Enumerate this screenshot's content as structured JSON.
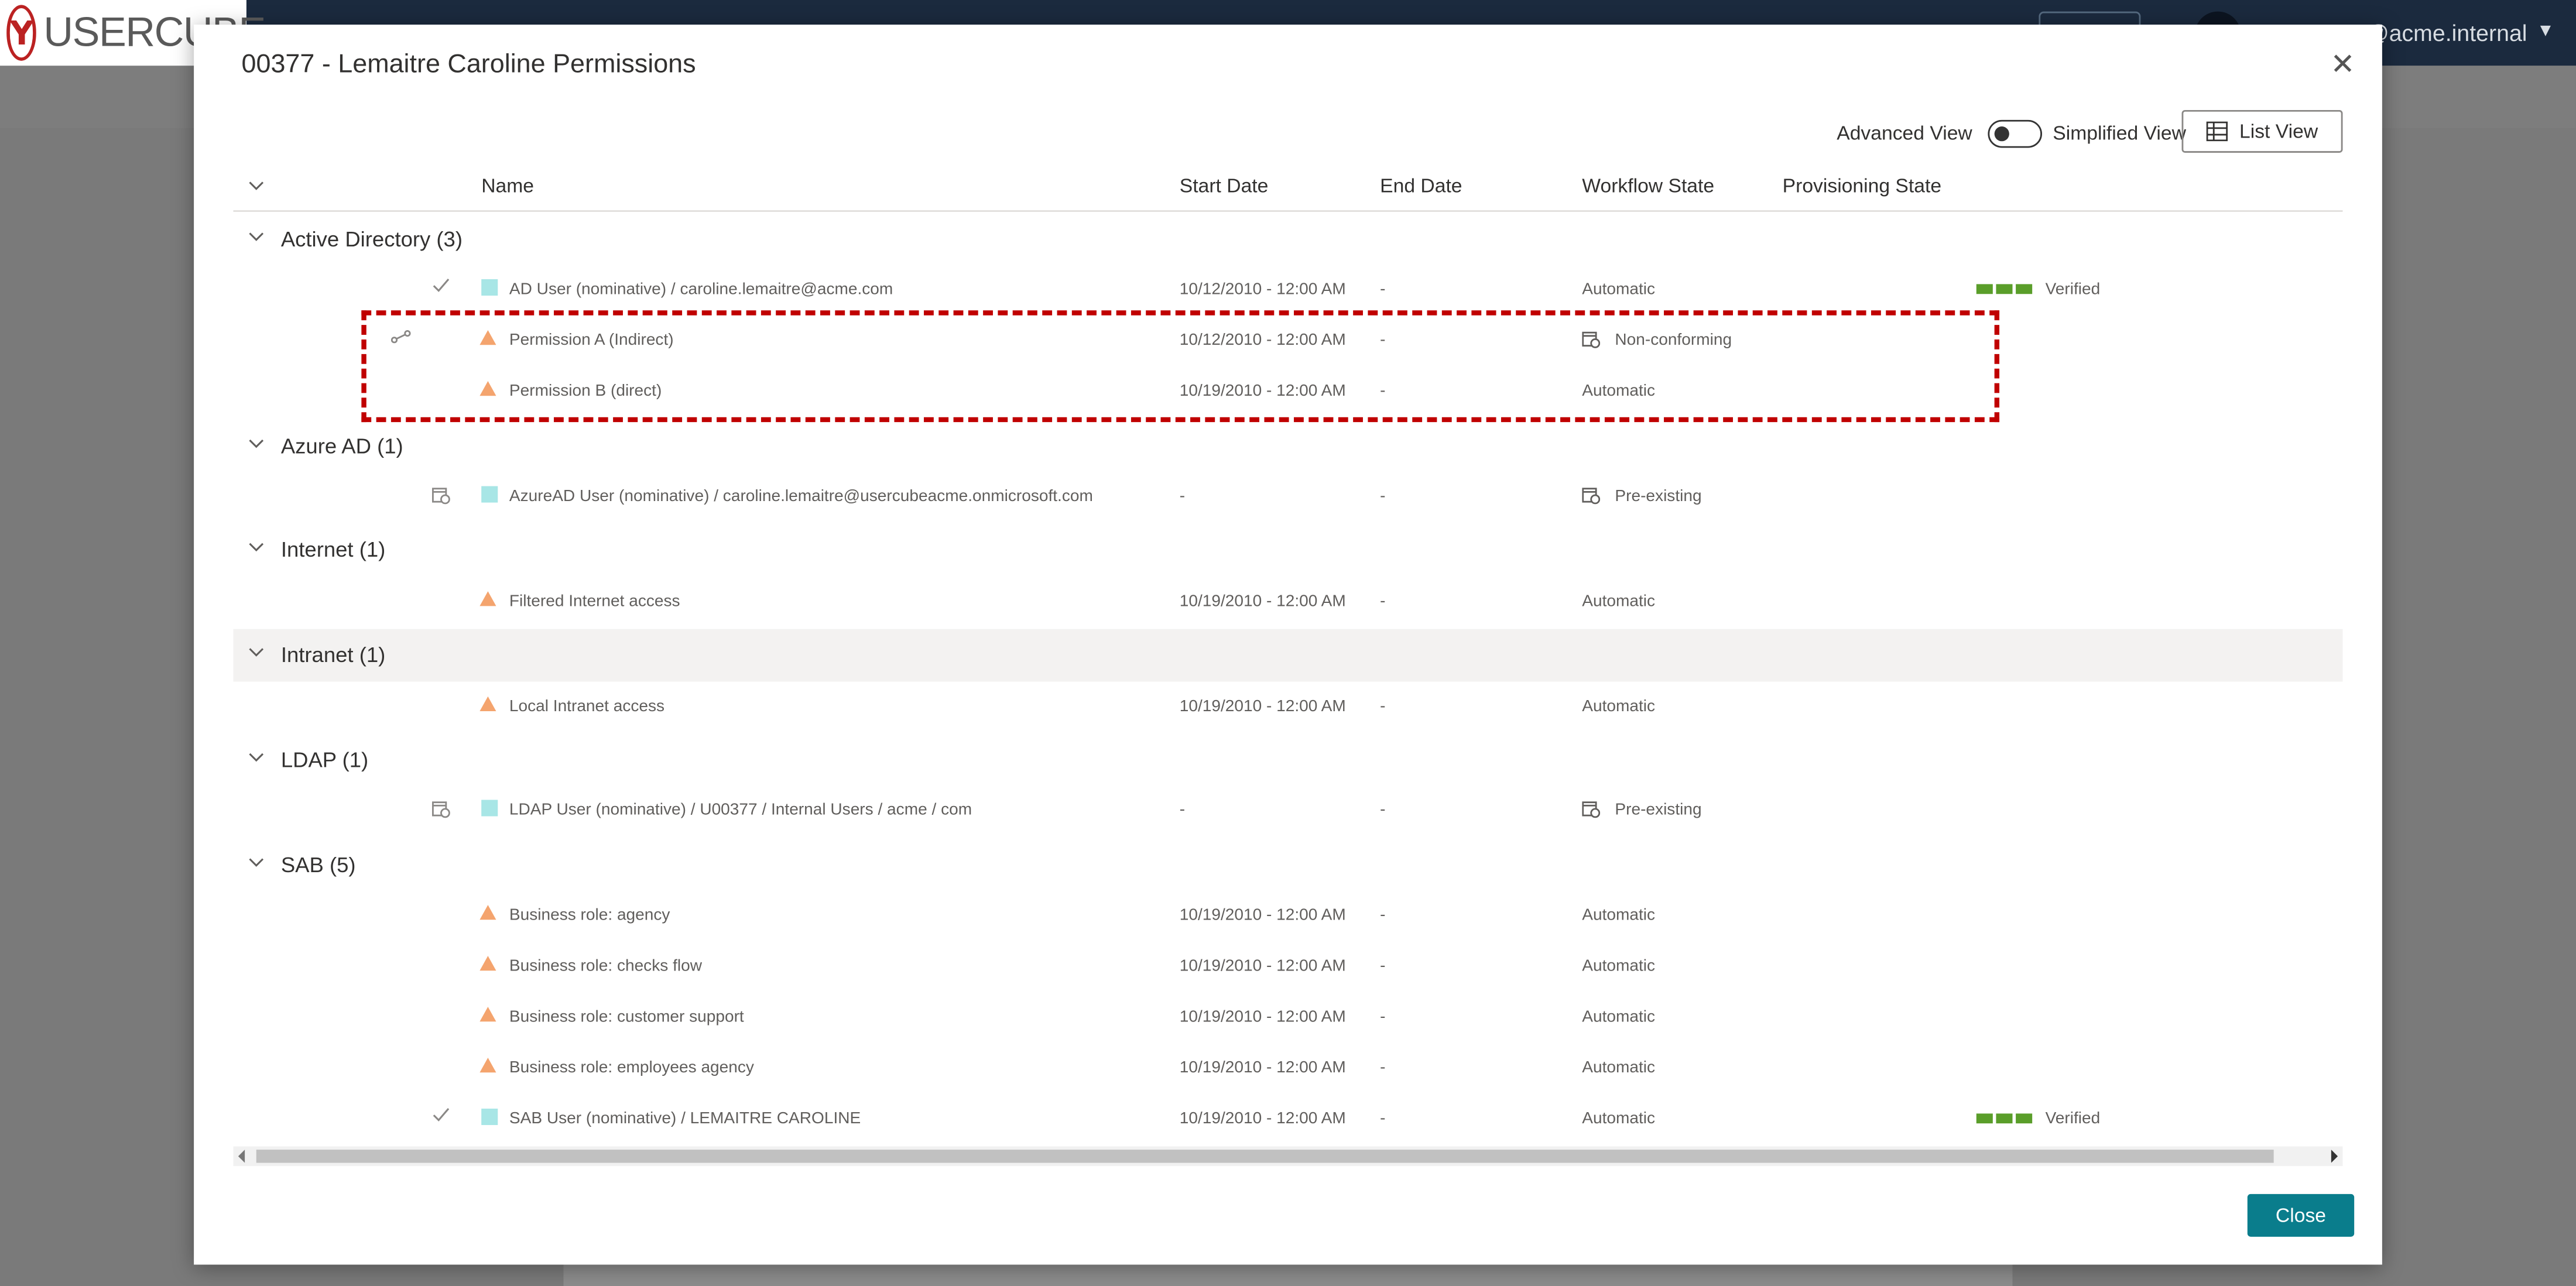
{
  "app": {
    "brand": "USERCUBE",
    "user": "@acme.internal"
  },
  "modal": {
    "title": "00377 - Lemaitre Caroline Permissions",
    "view_advanced": "Advanced View",
    "view_simplified": "Simplified View",
    "list_view": "List View",
    "close_label": "Close"
  },
  "columns": {
    "name": "Name",
    "start": "Start Date",
    "end": "End Date",
    "workflow": "Workflow State",
    "provisioning": "Provisioning State"
  },
  "groups": [
    {
      "label": "Active Directory (3)"
    },
    {
      "label": "Azure AD (1)"
    },
    {
      "label": "Internet (1)"
    },
    {
      "label": "Intranet (1)"
    },
    {
      "label": "LDAP (1)"
    },
    {
      "label": "SAB (5)"
    }
  ],
  "rows": [
    {
      "name": "AD User (nominative) / caroline.lemaitre@acme.com",
      "start": "10/12/2010  - 12:00 AM",
      "end": "-",
      "workflow": "Automatic",
      "provisioning": "Verified",
      "lead_icon": "check-icon",
      "type_icon": "resource-square-icon"
    },
    {
      "name": "Permission A (Indirect)",
      "start": "10/12/2010  - 12:00 AM",
      "end": "-",
      "workflow": "Non-conforming",
      "provisioning": "",
      "lead_icon": "link-icon",
      "type_icon": "assignment-triangle-icon"
    },
    {
      "name": "Permission B (direct)",
      "start": "10/19/2010  - 12:00 AM",
      "end": "-",
      "workflow": "Automatic",
      "provisioning": "",
      "lead_icon": "",
      "type_icon": "assignment-triangle-icon"
    },
    {
      "name": "AzureAD User (nominative) / caroline.lemaitre@usercubeacme.onmicrosoft.com",
      "start": "-",
      "end": "-",
      "workflow": "Pre-existing",
      "provisioning": "",
      "lead_icon": "calendar-clock-icon",
      "type_icon": "resource-square-icon"
    },
    {
      "name": "Filtered Internet access",
      "start": "10/19/2010  - 12:00 AM",
      "end": "-",
      "workflow": "Automatic",
      "provisioning": "",
      "lead_icon": "",
      "type_icon": "assignment-triangle-icon"
    },
    {
      "name": "Local Intranet access",
      "start": "10/19/2010  - 12:00 AM",
      "end": "-",
      "workflow": "Automatic",
      "provisioning": "",
      "lead_icon": "",
      "type_icon": "assignment-triangle-icon"
    },
    {
      "name": "LDAP User (nominative) / U00377 / Internal Users / acme / com",
      "start": "-",
      "end": "-",
      "workflow": "Pre-existing",
      "provisioning": "",
      "lead_icon": "calendar-clock-icon",
      "type_icon": "resource-square-icon"
    },
    {
      "name": "Business role: agency",
      "start": "10/19/2010  - 12:00 AM",
      "end": "-",
      "workflow": "Automatic",
      "provisioning": "",
      "lead_icon": "",
      "type_icon": "assignment-triangle-icon"
    },
    {
      "name": "Business role: checks flow",
      "start": "10/19/2010  - 12:00 AM",
      "end": "-",
      "workflow": "Automatic",
      "provisioning": "",
      "lead_icon": "",
      "type_icon": "assignment-triangle-icon"
    },
    {
      "name": "Business role: customer support",
      "start": "10/19/2010  - 12:00 AM",
      "end": "-",
      "workflow": "Automatic",
      "provisioning": "",
      "lead_icon": "",
      "type_icon": "assignment-triangle-icon"
    },
    {
      "name": "Business role: employees agency",
      "start": "10/19/2010  - 12:00 AM",
      "end": "-",
      "workflow": "Automatic",
      "provisioning": "",
      "lead_icon": "",
      "type_icon": "assignment-triangle-icon"
    },
    {
      "name": "SAB User (nominative) / LEMAITRE CAROLINE",
      "start": "10/19/2010  - 12:00 AM",
      "end": "-",
      "workflow": "Automatic",
      "provisioning": "Verified",
      "lead_icon": "check-icon",
      "type_icon": "resource-square-icon"
    }
  ],
  "colors": {
    "header_bg": "#1b2a3e",
    "primary_button": "#0a7d8c",
    "verified_green": "#5a9e2a",
    "assignment_orange": "#f4a46e",
    "resource_cyan": "#a8e6e6",
    "highlight_red": "#c00000",
    "selected_group_bg": "#f3f2f1"
  }
}
